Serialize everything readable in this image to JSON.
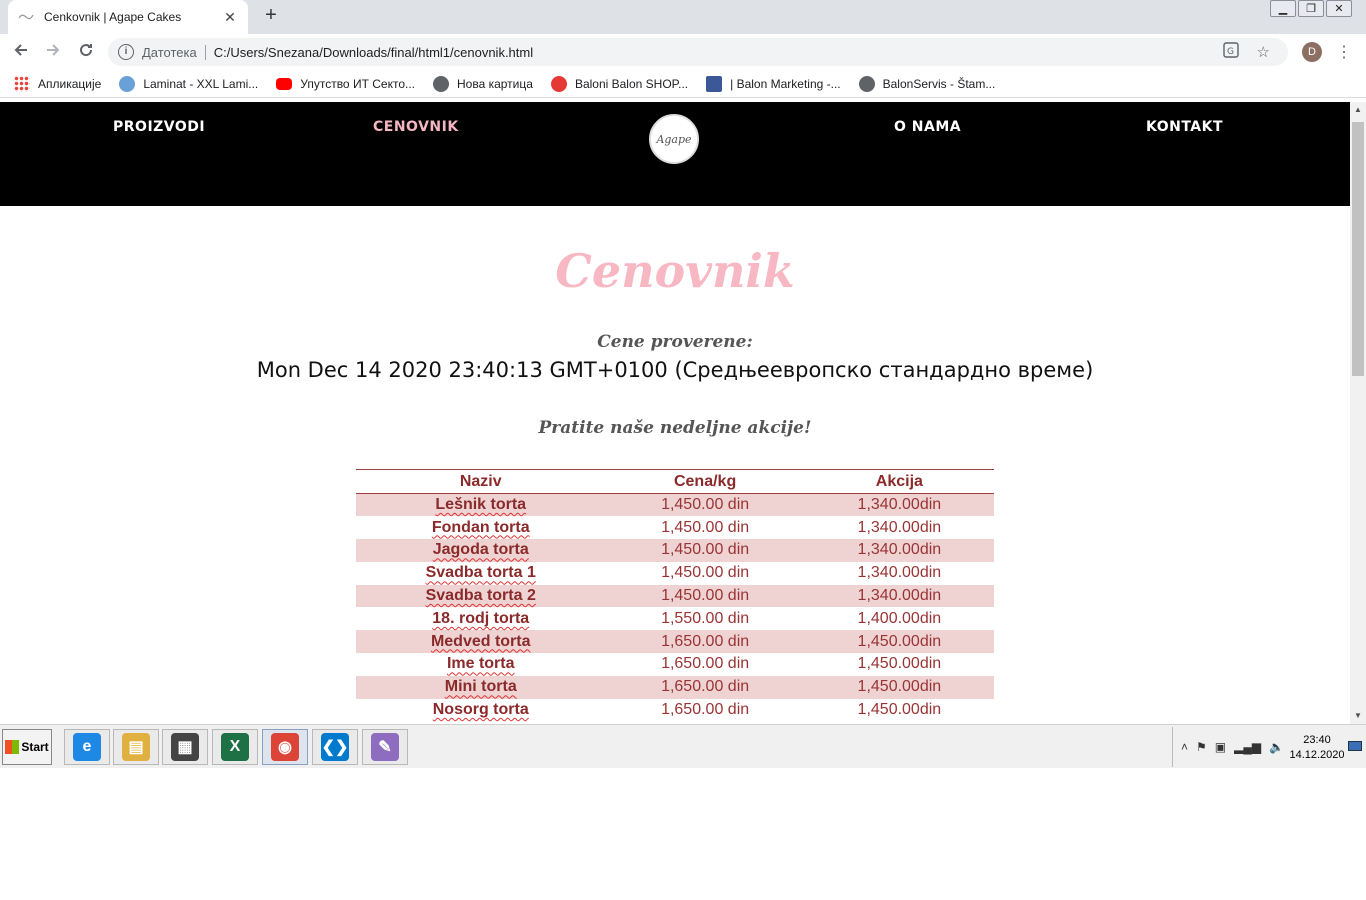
{
  "browser": {
    "tab_title": "Cenkovnik | Agape Cakes",
    "tab_close": "✕",
    "new_tab": "+",
    "window_controls": [
      "▁",
      "❐",
      "✕"
    ],
    "secure_label": "Датотека",
    "url": "C:/Users/Snezana/Downloads/final/html1/cenovnik.html",
    "profile_initial": "D",
    "bookmarks": [
      {
        "label": "Апликације",
        "color": "#e8453c"
      },
      {
        "label": "Laminat - XXL Lami...",
        "color": "#6aa0d8"
      },
      {
        "label": "Упутство ИТ Секто...",
        "color": "#ff0000"
      },
      {
        "label": "Нова картица",
        "color": "#5f6368"
      },
      {
        "label": "Baloni Balon SHOP...",
        "color": "#e53935"
      },
      {
        "label": "| Balon Marketing -...",
        "color": "#3b5998"
      },
      {
        "label": "BalonServis - Štam...",
        "color": "#5f6368"
      }
    ]
  },
  "site": {
    "nav": [
      {
        "label": "PROIZVODI",
        "active": false
      },
      {
        "label": "CENOVNIK",
        "active": true
      },
      {
        "label": "O NAMA",
        "active": false
      },
      {
        "label": "KONTAKT",
        "active": false
      }
    ],
    "logo_text": "Agape",
    "page_title": "Cenovnik",
    "checked_label": "Cene proverene:",
    "datetime": "Mon Dec 14 2020 23:40:13 GMT+0100 (Средњеевропско стандардно време)",
    "weekly_note": "Pratite naše nedeljne akcije!",
    "table": {
      "headers": [
        "Naziv",
        "Cena/kg",
        "Akcija"
      ],
      "rows": [
        [
          "Lešnik torta",
          "1,450.00 din",
          "1,340.00din"
        ],
        [
          "Fondan torta",
          "1,450.00 din",
          "1,340.00din"
        ],
        [
          "Jagoda torta",
          "1,450.00 din",
          "1,340.00din"
        ],
        [
          "Svadba torta 1",
          "1,450.00 din",
          "1,340.00din"
        ],
        [
          "Svadba torta 2",
          "1,450.00 din",
          "1,340.00din"
        ],
        [
          "18. rodj torta",
          "1,550.00 din",
          "1,400.00din"
        ],
        [
          "Medved torta",
          "1,650.00 din",
          "1,450.00din"
        ],
        [
          "Ime torta",
          "1,650.00 din",
          "1,450.00din"
        ],
        [
          "Mini torta",
          "1,650.00 din",
          "1,450.00din"
        ],
        [
          "Nosorg torta",
          "1,650.00 din",
          "1,450.00din"
        ]
      ]
    }
  },
  "taskbar": {
    "start_label": "Start",
    "apps": [
      {
        "name": "internet-explorer-icon",
        "glyph": "e",
        "color": "#1e88e5"
      },
      {
        "name": "file-explorer-icon",
        "glyph": "▤",
        "color": "#e0b040"
      },
      {
        "name": "calculator-icon",
        "glyph": "▦",
        "color": "#444"
      },
      {
        "name": "excel-icon",
        "glyph": "X",
        "color": "#1e7145"
      },
      {
        "name": "chrome-icon",
        "glyph": "◉",
        "color": "#db4437"
      },
      {
        "name": "vscode-icon",
        "glyph": "❮❯",
        "color": "#007acc"
      },
      {
        "name": "paint-icon",
        "glyph": "✎",
        "color": "#8e6cc0"
      }
    ],
    "tray_expand": "˄",
    "clock_time": "23:40",
    "clock_date": "14.12.2020"
  }
}
